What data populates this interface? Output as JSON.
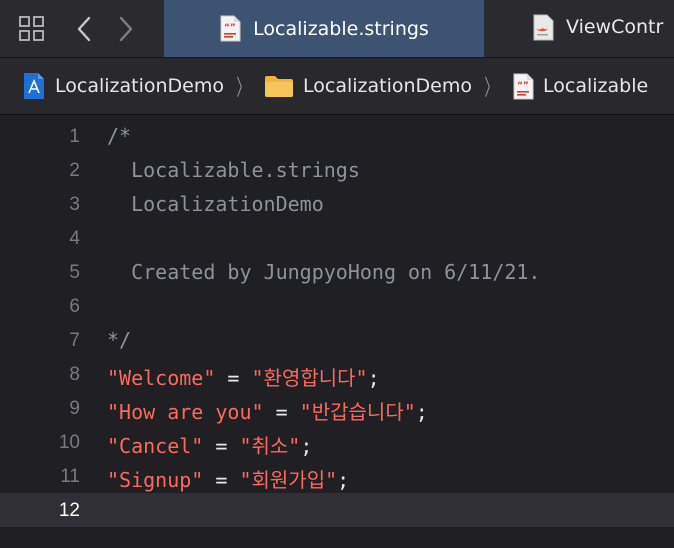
{
  "tabs": {
    "active": {
      "title": "Localizable.strings",
      "icon": "strings-file-icon"
    },
    "inactive": {
      "title": "ViewContr",
      "icon": "swift-file-icon"
    }
  },
  "breadcrumb": [
    {
      "label": "LocalizationDemo",
      "icon": "xcode-project-icon"
    },
    {
      "label": "LocalizationDemo",
      "icon": "folder-icon"
    },
    {
      "label": "Localizable",
      "icon": "strings-file-icon"
    }
  ],
  "editor": {
    "current_line": 12,
    "lines": [
      {
        "n": "1",
        "comment": "/*"
      },
      {
        "n": "2",
        "comment": "  Localizable.strings"
      },
      {
        "n": "3",
        "comment": "  LocalizationDemo"
      },
      {
        "n": "4",
        "comment": ""
      },
      {
        "n": "5",
        "comment": "  Created by JungpyoHong on 6/11/21."
      },
      {
        "n": "6",
        "comment": ""
      },
      {
        "n": "7",
        "comment": "*/"
      },
      {
        "n": "8",
        "key": "\"Welcome\"",
        "value": "\"환영합니다\""
      },
      {
        "n": "9",
        "key": "\"How are you\"",
        "value": "\"반갑습니다\""
      },
      {
        "n": "10",
        "key": "\"Cancel\"",
        "value": "\"취소\""
      },
      {
        "n": "11",
        "key": "\"Signup\"",
        "value": "\"회원가입\""
      },
      {
        "n": "12",
        "comment": ""
      }
    ],
    "assign": " = ",
    "terminator": ";"
  },
  "colors": {
    "string": "#fc6a5d",
    "comment": "#8f9298",
    "active_tab": "#3c5471"
  }
}
